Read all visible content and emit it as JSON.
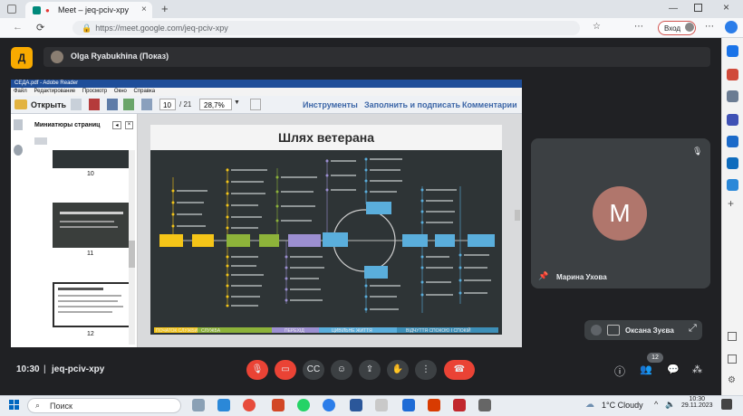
{
  "browser": {
    "tab_title": "Meet – jeq-pciv-xpy",
    "url": "https://meet.google.com/jeq-pciv-xpy",
    "login_label": "Вход"
  },
  "meet": {
    "presenter_label": "Olga Ryabukhina (Показ)",
    "time": "10:30",
    "separator": "|",
    "meeting_code": "jeq-pciv-xpy",
    "participants_count": "12",
    "participants": [
      {
        "name": "Марина Ухова",
        "initial": "М"
      },
      {
        "name": "Оксана Зуєва"
      }
    ]
  },
  "acrobat": {
    "title": "СЕДА.pdf - Adobe Reader",
    "menu": [
      "Файл",
      "Редактирование",
      "Просмотр",
      "Окно",
      "Справка"
    ],
    "open_label": "Открыть",
    "page_current": "10",
    "page_total": "/ 21",
    "zoom": "28,7%",
    "tools": [
      "Инструменты",
      "Заполнить и подписать",
      "Комментарии"
    ],
    "thumbnails_title": "Миниатюры страниц",
    "thumb_pages": [
      "10",
      "11",
      "12"
    ]
  },
  "slide": {
    "title": "Шлях ветерана",
    "main_nodes": [
      "Початок служби",
      "Служба",
      "Бойові",
      "Вихід зі служби",
      "Перехід цивільне життя",
      "Повернення до сім'ї",
      "Пошук роботи",
      "Навчання",
      "Робота",
      "Сім'я"
    ],
    "phases": [
      "ПОЧАТОК СЛУЖБИ",
      "СЛУЖБА",
      "ПЕРЕХІД",
      "ЦИВІЛЬНЕ ЖИТТЯ",
      "ВІДЧУТТЯ СПОКОЮ І СПОКІЙ"
    ]
  },
  "taskbar": {
    "search_placeholder": "Поиск",
    "weather": "1°C  Cloudy",
    "clock_time": "10:30",
    "clock_date": "29.11.2023"
  },
  "colors": {
    "meet_bg": "#202124",
    "hangup": "#ea4335",
    "slide_bg": "#2e3436",
    "node_yellow": "#f5c518",
    "node_green": "#8db33a",
    "node_purple": "#9c8fd1",
    "node_blue": "#5aaedc",
    "avatar": "#b0766c"
  }
}
